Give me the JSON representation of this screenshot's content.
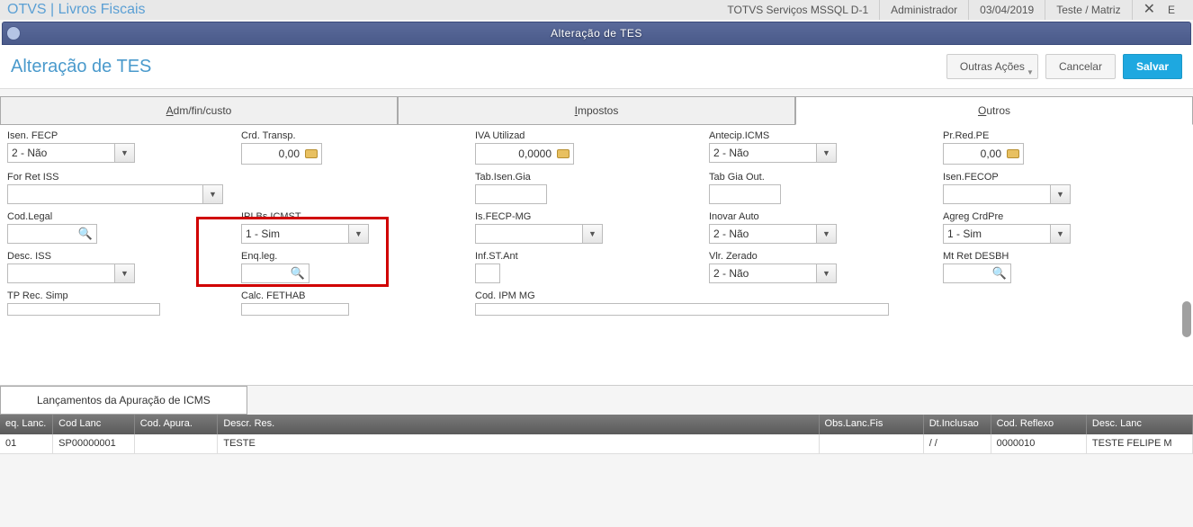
{
  "top": {
    "app": "OTVS | Livros Fiscais",
    "env": "TOTVS Serviços MSSQL D-1",
    "user": "Administrador",
    "date": "03/04/2019",
    "branch": "Teste / Matriz",
    "ex": "E"
  },
  "titlebar": "Alteração de TES",
  "subheader": {
    "title": "Alteração de TES",
    "actions": {
      "outras": "Outras Ações",
      "cancelar": "Cancelar",
      "salvar": "Salvar"
    }
  },
  "tabs": {
    "adm": {
      "u": "A",
      "rest": "dm/fin/custo"
    },
    "imp": {
      "u": "I",
      "rest": "mpostos"
    },
    "out": {
      "u": "O",
      "rest": "utros"
    }
  },
  "form": {
    "r1": {
      "isen_fecp": {
        "label": "Isen. FECP",
        "value": "2 - Não"
      },
      "crd_transp": {
        "label": "Crd. Transp.",
        "value": "0,00"
      },
      "iva_utilizad": {
        "label": "IVA Utilizad",
        "value": "0,0000"
      },
      "antecip_icms": {
        "label": "Antecip.ICMS",
        "value": "2 - Não"
      },
      "prred_pe": {
        "label": "Pr.Red.PE",
        "value": "0,00"
      }
    },
    "r2": {
      "for_ret_iss": {
        "label": "For Ret ISS"
      },
      "tab_isen_gia": {
        "label": "Tab.Isen.Gia"
      },
      "tab_gia_out": {
        "label": "Tab Gia Out."
      },
      "isen_fecop": {
        "label": "Isen.FECOP"
      }
    },
    "r3": {
      "cod_legal": {
        "label": "Cod.Legal"
      },
      "ipi_bs_icmst": {
        "label": "IPI Bs.ICMST",
        "value": "1 - Sim"
      },
      "is_fecp_mg": {
        "label": "Is.FECP-MG"
      },
      "inovar_auto": {
        "label": "Inovar Auto",
        "value": "2 - Não"
      },
      "agreg_crdpre": {
        "label": "Agreg CrdPre",
        "value": "1 - Sim"
      }
    },
    "r4": {
      "desc_iss": {
        "label": "Desc. ISS"
      },
      "enq_leg": {
        "label": "Enq.leg."
      },
      "inf_st_ant": {
        "label": "Inf.ST.Ant"
      },
      "vlr_zerado": {
        "label": "Vlr. Zerado",
        "value": "2 - Não"
      },
      "mt_ret_desbh": {
        "label": "Mt Ret DESBH"
      }
    },
    "r5": {
      "tp_rec_simp": {
        "label": "TP Rec. Simp"
      },
      "calc_fethab": {
        "label": "Calc. FETHAB"
      },
      "cod_ipm_mg": {
        "label": "Cod. IPM MG"
      }
    }
  },
  "gridtab": "Lançamentos da Apuração de ICMS",
  "gridhead": [
    "eq. Lanc.",
    "Cod Lanc",
    "Cod. Apura.",
    "Descr. Res.",
    "Obs.Lanc.Fis",
    "Dt.Inclusao",
    "Cod. Reflexo",
    "Desc. Lanc"
  ],
  "gridrow": [
    "01",
    "SP00000001",
    "",
    "TESTE",
    "",
    "/  /",
    "0000010",
    "TESTE FELIPE M"
  ]
}
